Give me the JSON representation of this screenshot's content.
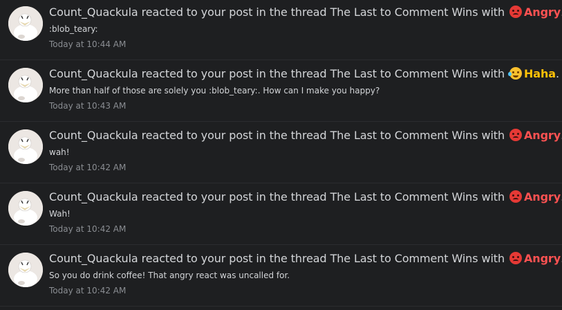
{
  "alerts": [
    {
      "user": "Count_Quackula",
      "text": "reacted to your post in the thread",
      "thread": "The Last to Comment Wins",
      "with": "with",
      "reaction": "Angry",
      "reaction_type": "angry",
      "period": ".",
      "snippet": ":blob_teary:",
      "time": "Today at 10:44 AM"
    },
    {
      "user": "Count_Quackula",
      "text": "reacted to your post in the thread",
      "thread": "The Last to Comment Wins",
      "with": "with",
      "reaction": "Haha",
      "reaction_type": "haha",
      "period": ".",
      "snippet": "More than half of those are solely you :blob_teary:. How can I make you happy?",
      "time": "Today at 10:43 AM"
    },
    {
      "user": "Count_Quackula",
      "text": "reacted to your post in the thread",
      "thread": "The Last to Comment Wins",
      "with": "with",
      "reaction": "Angry",
      "reaction_type": "angry",
      "period": ".",
      "snippet": "wah!",
      "time": "Today at 10:42 AM"
    },
    {
      "user": "Count_Quackula",
      "text": "reacted to your post in the thread",
      "thread": "The Last to Comment Wins",
      "with": "with",
      "reaction": "Angry",
      "reaction_type": "angry",
      "period": ".",
      "snippet": "Wah!",
      "time": "Today at 10:42 AM"
    },
    {
      "user": "Count_Quackula",
      "text": "reacted to your post in the thread",
      "thread": "The Last to Comment Wins",
      "with": "with",
      "reaction": "Angry",
      "reaction_type": "angry",
      "period": ".",
      "snippet": "So you do drink coffee! That angry react was uncalled for.",
      "time": "Today at 10:42 AM"
    }
  ],
  "icons": {
    "avatar": "duck-avatar-icon",
    "angry": "angry-face-emoji-icon",
    "haha": "laughing-face-emoji-icon"
  },
  "colors": {
    "background": "#1e1f21",
    "text": "#d3d5d8",
    "muted": "#8a8d92",
    "angry": "#ff5252",
    "haha": "#ffc107"
  }
}
